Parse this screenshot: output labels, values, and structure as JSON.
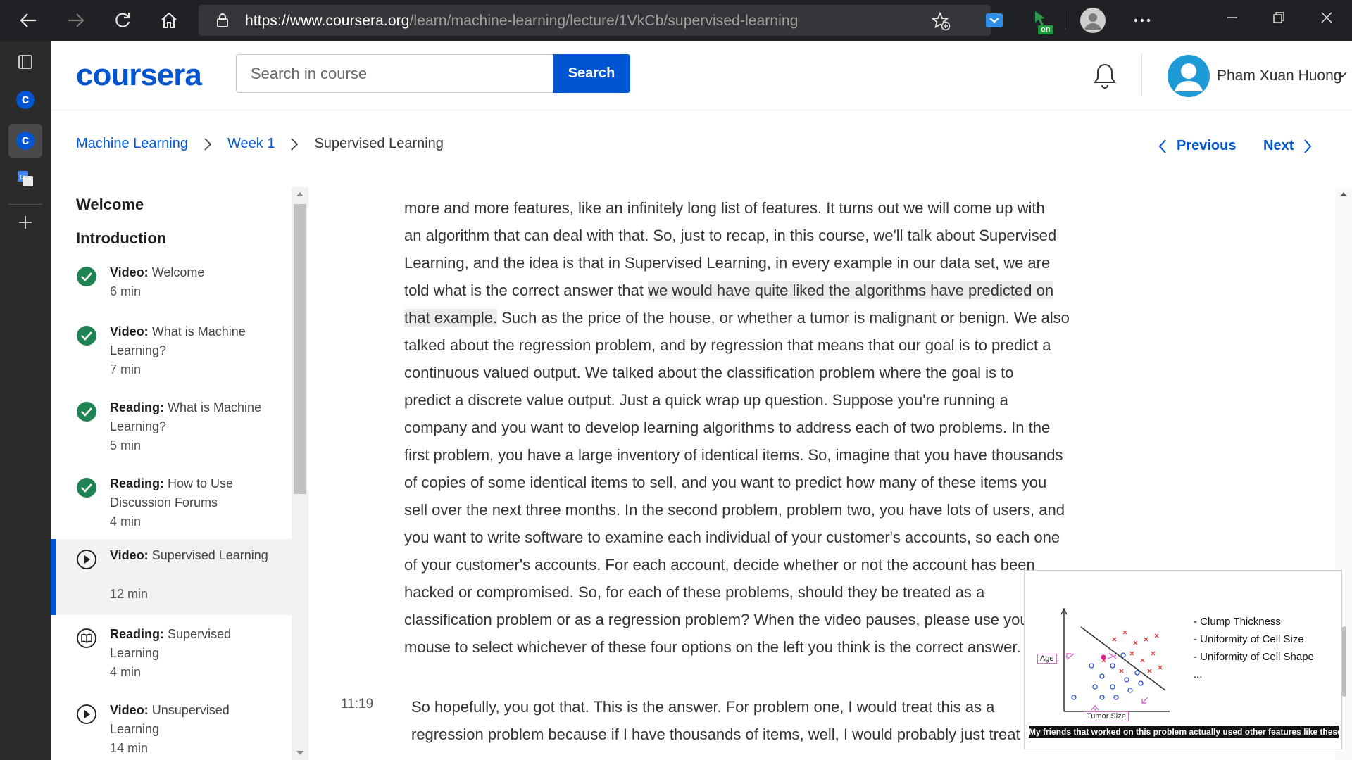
{
  "browser": {
    "url_host": "https://www.coursera.org",
    "url_path": "/learn/machine-learning/lecture/1VkCb/supervised-learning",
    "extension_badge": "on"
  },
  "header": {
    "logo": "coursera",
    "search_placeholder": "Search in course",
    "search_button": "Search",
    "user_name": "Pham Xuan Huong"
  },
  "breadcrumb": {
    "items": [
      "Machine Learning",
      "Week 1",
      "Supervised Learning"
    ],
    "previous": "Previous",
    "next": "Next"
  },
  "sidebar": {
    "sections": [
      "Welcome",
      "Introduction"
    ],
    "lessons": [
      {
        "type": "Video:",
        "title": "Welcome",
        "duration": "6 min",
        "status": "completed"
      },
      {
        "type": "Video:",
        "title": "What is Machine Learning?",
        "duration": "7 min",
        "status": "completed"
      },
      {
        "type": "Reading:",
        "title": "What is Machine Learning?",
        "duration": "5 min",
        "status": "completed"
      },
      {
        "type": "Reading:",
        "title": "How to Use Discussion Forums",
        "duration": "4 min",
        "status": "completed"
      },
      {
        "type": "Video:",
        "title": "Supervised Learning",
        "duration": "12 min",
        "status": "current"
      },
      {
        "type": "Reading:",
        "title": "Supervised Learning",
        "duration": "4 min",
        "status": "reading"
      },
      {
        "type": "Video:",
        "title": "Unsupervised Learning",
        "duration": "14 min",
        "status": "video"
      }
    ]
  },
  "transcript": {
    "lines": [
      "more and more features, like an infinitely long list of features. It turns out we will come up with",
      "an algorithm that can deal with that. So, just to recap, in this course, we'll talk about Supervised",
      "Learning, and the idea is that in Supervised Learning, in every example in our data set, we are",
      "told what is the correct answer that ",
      "that example.",
      "talked about the regression problem, and by regression that means that our goal is to predict a",
      "continuous valued output. We talked about the classification problem where the goal is to",
      "predict a discrete value output. Just a quick wrap up question. Suppose you're running a",
      "company and you want to develop learning algorithms to address each of two problems. In the",
      "first problem, you have a large inventory of identical items. So, imagine that you have thousands",
      "of copies of some identical items to sell, and you want to predict how many of these items you",
      "sell over the next three months. In the second problem, problem two, you have lots of users, and",
      "you want to write software to examine each individual of your customer's accounts, so each one",
      "of your customer's accounts. For each account, decide whether or not the account has been",
      "hacked or compromised. So, for each of these problems, should they be treated as a",
      "classification problem or as a regression problem? When the video pauses, please use your",
      "mouse to select whichever of these four options on the left you think is the correct answer."
    ],
    "highlight_1": "we would have quite liked the algorithms have predicted on",
    "line5_rest": " Such as the price of the house, or whether a tumor is malignant or benign. We also",
    "timestamp": "11:19",
    "lines2": [
      "So hopefully, you got that. This is the answer. For problem one, I would treat this as a",
      "regression problem because if I have thousands of items, well, I would probably just treat"
    ]
  },
  "video": {
    "bullets": [
      "-  Clump Thickness",
      "-  Uniformity of Cell Size",
      "-  Uniformity of Cell Shape",
      "..."
    ],
    "x_label": "Tumor Size",
    "y_label": "Age",
    "caption": "My friends that worked on this problem actually used other features like these,"
  }
}
